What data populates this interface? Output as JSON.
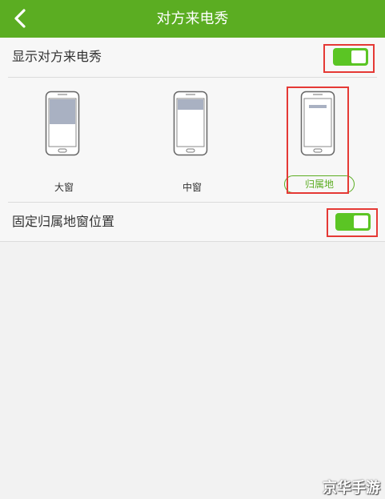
{
  "header": {
    "title": "对方来电秀",
    "back_icon": "chevron-left-icon"
  },
  "settings": {
    "show_callshow": {
      "label": "显示对方来电秀",
      "enabled": true
    },
    "fix_location_window": {
      "label": "固定归属地窗位置",
      "enabled": true
    }
  },
  "window_options": [
    {
      "label": "大窗",
      "selected": false
    },
    {
      "label": "中窗",
      "selected": false
    },
    {
      "label": "归属地",
      "selected": true
    }
  ],
  "colors": {
    "header_bg": "#5bad22",
    "toggle_on": "#5bc524",
    "highlight": "#e53935",
    "preview_fill": "#a9b1c2"
  },
  "watermark": "京华手游"
}
